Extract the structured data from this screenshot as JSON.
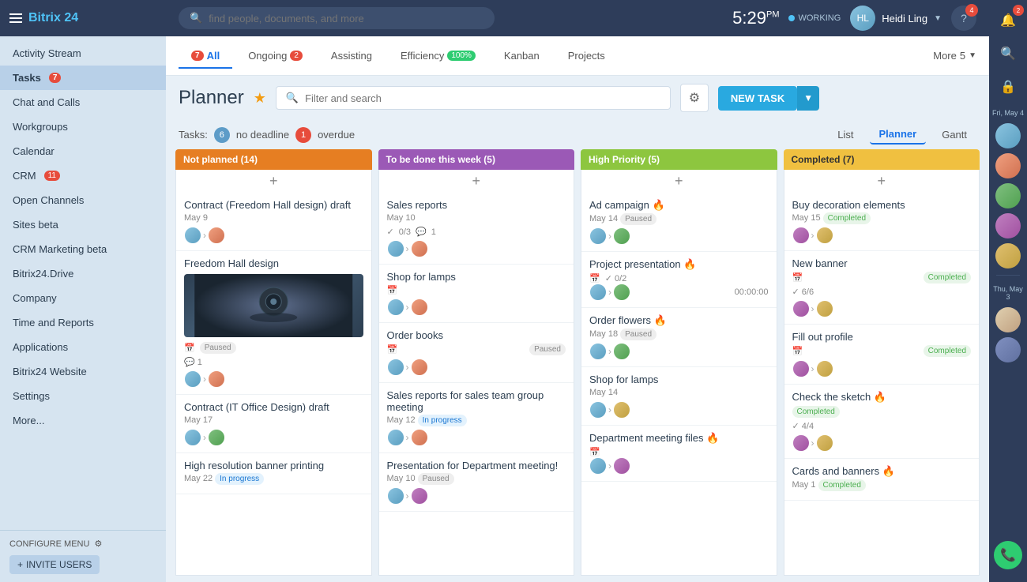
{
  "app": {
    "name": "Bitrix",
    "number": "24"
  },
  "topbar": {
    "search_placeholder": "find people, documents, and more",
    "clock": "5:29",
    "clock_period": "PM",
    "status": "WORKING",
    "user_name": "Heidi Ling"
  },
  "tabs": [
    {
      "label": "All",
      "badge": "7",
      "badge_color": "red",
      "active": true
    },
    {
      "label": "Ongoing",
      "badge": "2",
      "badge_color": "red"
    },
    {
      "label": "Assisting",
      "badge": null
    },
    {
      "label": "Efficiency",
      "badge": "100%",
      "badge_color": "green"
    },
    {
      "label": "Kanban",
      "badge": null
    },
    {
      "label": "Projects",
      "badge": null
    }
  ],
  "tab_more": {
    "label": "More",
    "badge": "5",
    "badge_color": "red"
  },
  "planner": {
    "title": "Planner",
    "filter_placeholder": "Filter and search",
    "new_task_label": "NEW TASK",
    "tasks_label": "Tasks:",
    "no_deadline_count": "6",
    "no_deadline_label": "no deadline",
    "overdue_count": "1",
    "overdue_label": "overdue",
    "views": [
      "List",
      "Planner",
      "Gantt"
    ],
    "active_view": "Planner"
  },
  "columns": [
    {
      "id": "not-planned",
      "label": "Not planned",
      "count": 14,
      "color_class": "not-planned",
      "cards": [
        {
          "title": "Contract (Freedom Hall design) draft",
          "date": "May 9",
          "avatar1": "a1",
          "avatar2": "a2",
          "status": null,
          "meta": null
        },
        {
          "title": "Freedom Hall design",
          "date": null,
          "has_image": true,
          "status": "Paused",
          "meta_count": "1"
        },
        {
          "title": "Contract (IT Office Design) draft",
          "date": "May 17",
          "avatar1": "a1",
          "avatar2": "a3",
          "status": null
        },
        {
          "title": "High resolution banner printing",
          "date": "May 22",
          "status": "In progress"
        }
      ]
    },
    {
      "id": "this-week",
      "label": "To be done this week",
      "count": 5,
      "color_class": "this-week",
      "cards": [
        {
          "title": "Sales reports",
          "date": "May 10",
          "check": "0/3",
          "comment": "1",
          "avatar1": "a1",
          "avatar2": "a2"
        },
        {
          "title": "Shop for lamps",
          "date": null,
          "avatar1": "a1",
          "avatar2": "a2",
          "has_calendar": true
        },
        {
          "title": "Order books",
          "date": null,
          "status": "Paused",
          "avatar1": "a1",
          "avatar2": "a2",
          "has_calendar": true
        },
        {
          "title": "Sales reports for sales team group meeting",
          "date": "May 12",
          "status": "In progress",
          "avatar1": "a1",
          "avatar2": "a2"
        },
        {
          "title": "Presentation for Department meeting!",
          "date": "May 10",
          "status": "Paused",
          "avatar1": "a1",
          "avatar2": "a4"
        }
      ]
    },
    {
      "id": "high-priority",
      "label": "High Priority",
      "count": 5,
      "color_class": "high-priority",
      "cards": [
        {
          "title": "Ad campaign 🔥",
          "date": "May 14",
          "status": "Paused",
          "avatar1": "a1",
          "avatar2": "a3",
          "fire": true
        },
        {
          "title": "Project presentation 🔥",
          "date": null,
          "check": "0/2",
          "time": "00:00:00",
          "avatar1": "a1",
          "avatar2": "a3",
          "fire": true
        },
        {
          "title": "Order flowers 🔥",
          "date": "May 18",
          "status": "Paused",
          "avatar1": "a1",
          "avatar2": "a3",
          "fire": true
        },
        {
          "title": "Shop for lamps",
          "date": "May 14",
          "avatar1": "a1",
          "avatar2": "a5"
        },
        {
          "title": "Department meeting files 🔥",
          "date": null,
          "avatar1": "a1",
          "avatar2": "a4",
          "fire": true
        }
      ]
    },
    {
      "id": "completed",
      "label": "Completed",
      "count": 7,
      "color_class": "completed",
      "cards": [
        {
          "title": "Buy decoration elements",
          "date": "May 15",
          "status": "Completed",
          "avatar1": "a4",
          "avatar2": "a5"
        },
        {
          "title": "New banner",
          "date": null,
          "status": "Completed",
          "check": "6/6",
          "avatar1": "a4",
          "avatar2": "a5"
        },
        {
          "title": "Fill out profile",
          "date": null,
          "status": "Completed",
          "has_calendar": true,
          "avatar1": "a4",
          "avatar2": "a5"
        },
        {
          "title": "Check the sketch 🔥",
          "date": null,
          "status": "Completed",
          "check": "4/4",
          "avatar1": "a4",
          "avatar2": "a5",
          "fire": true
        },
        {
          "title": "Cards and banners 🔥",
          "date": "May 1",
          "status": "Completed",
          "avatar1": "a4",
          "avatar2": "a5",
          "fire": true
        }
      ]
    }
  ],
  "sidebar": {
    "items": [
      {
        "label": "Activity Stream",
        "badge": null
      },
      {
        "label": "Tasks",
        "badge": "7",
        "active": true
      },
      {
        "label": "Chat and Calls",
        "badge": null
      },
      {
        "label": "Workgroups",
        "badge": null
      },
      {
        "label": "Calendar",
        "badge": null
      },
      {
        "label": "CRM",
        "badge": "11"
      },
      {
        "label": "Open Channels",
        "badge": null
      },
      {
        "label": "Sites beta",
        "badge": null
      },
      {
        "label": "CRM Marketing beta",
        "badge": null
      },
      {
        "label": "Bitrix24.Drive",
        "badge": null
      },
      {
        "label": "Company",
        "badge": null
      },
      {
        "label": "Time and Reports",
        "badge": null
      },
      {
        "label": "Applications",
        "badge": null
      },
      {
        "label": "Bitrix24 Website",
        "badge": null
      },
      {
        "label": "Settings",
        "badge": null
      },
      {
        "label": "More...",
        "badge": null
      }
    ],
    "configure_menu": "CONFIGURE MENU",
    "invite_users": "INVITE USERS"
  },
  "right_sidebar": {
    "date1": "Fri, May 4",
    "date2": "Thu, May 3"
  }
}
